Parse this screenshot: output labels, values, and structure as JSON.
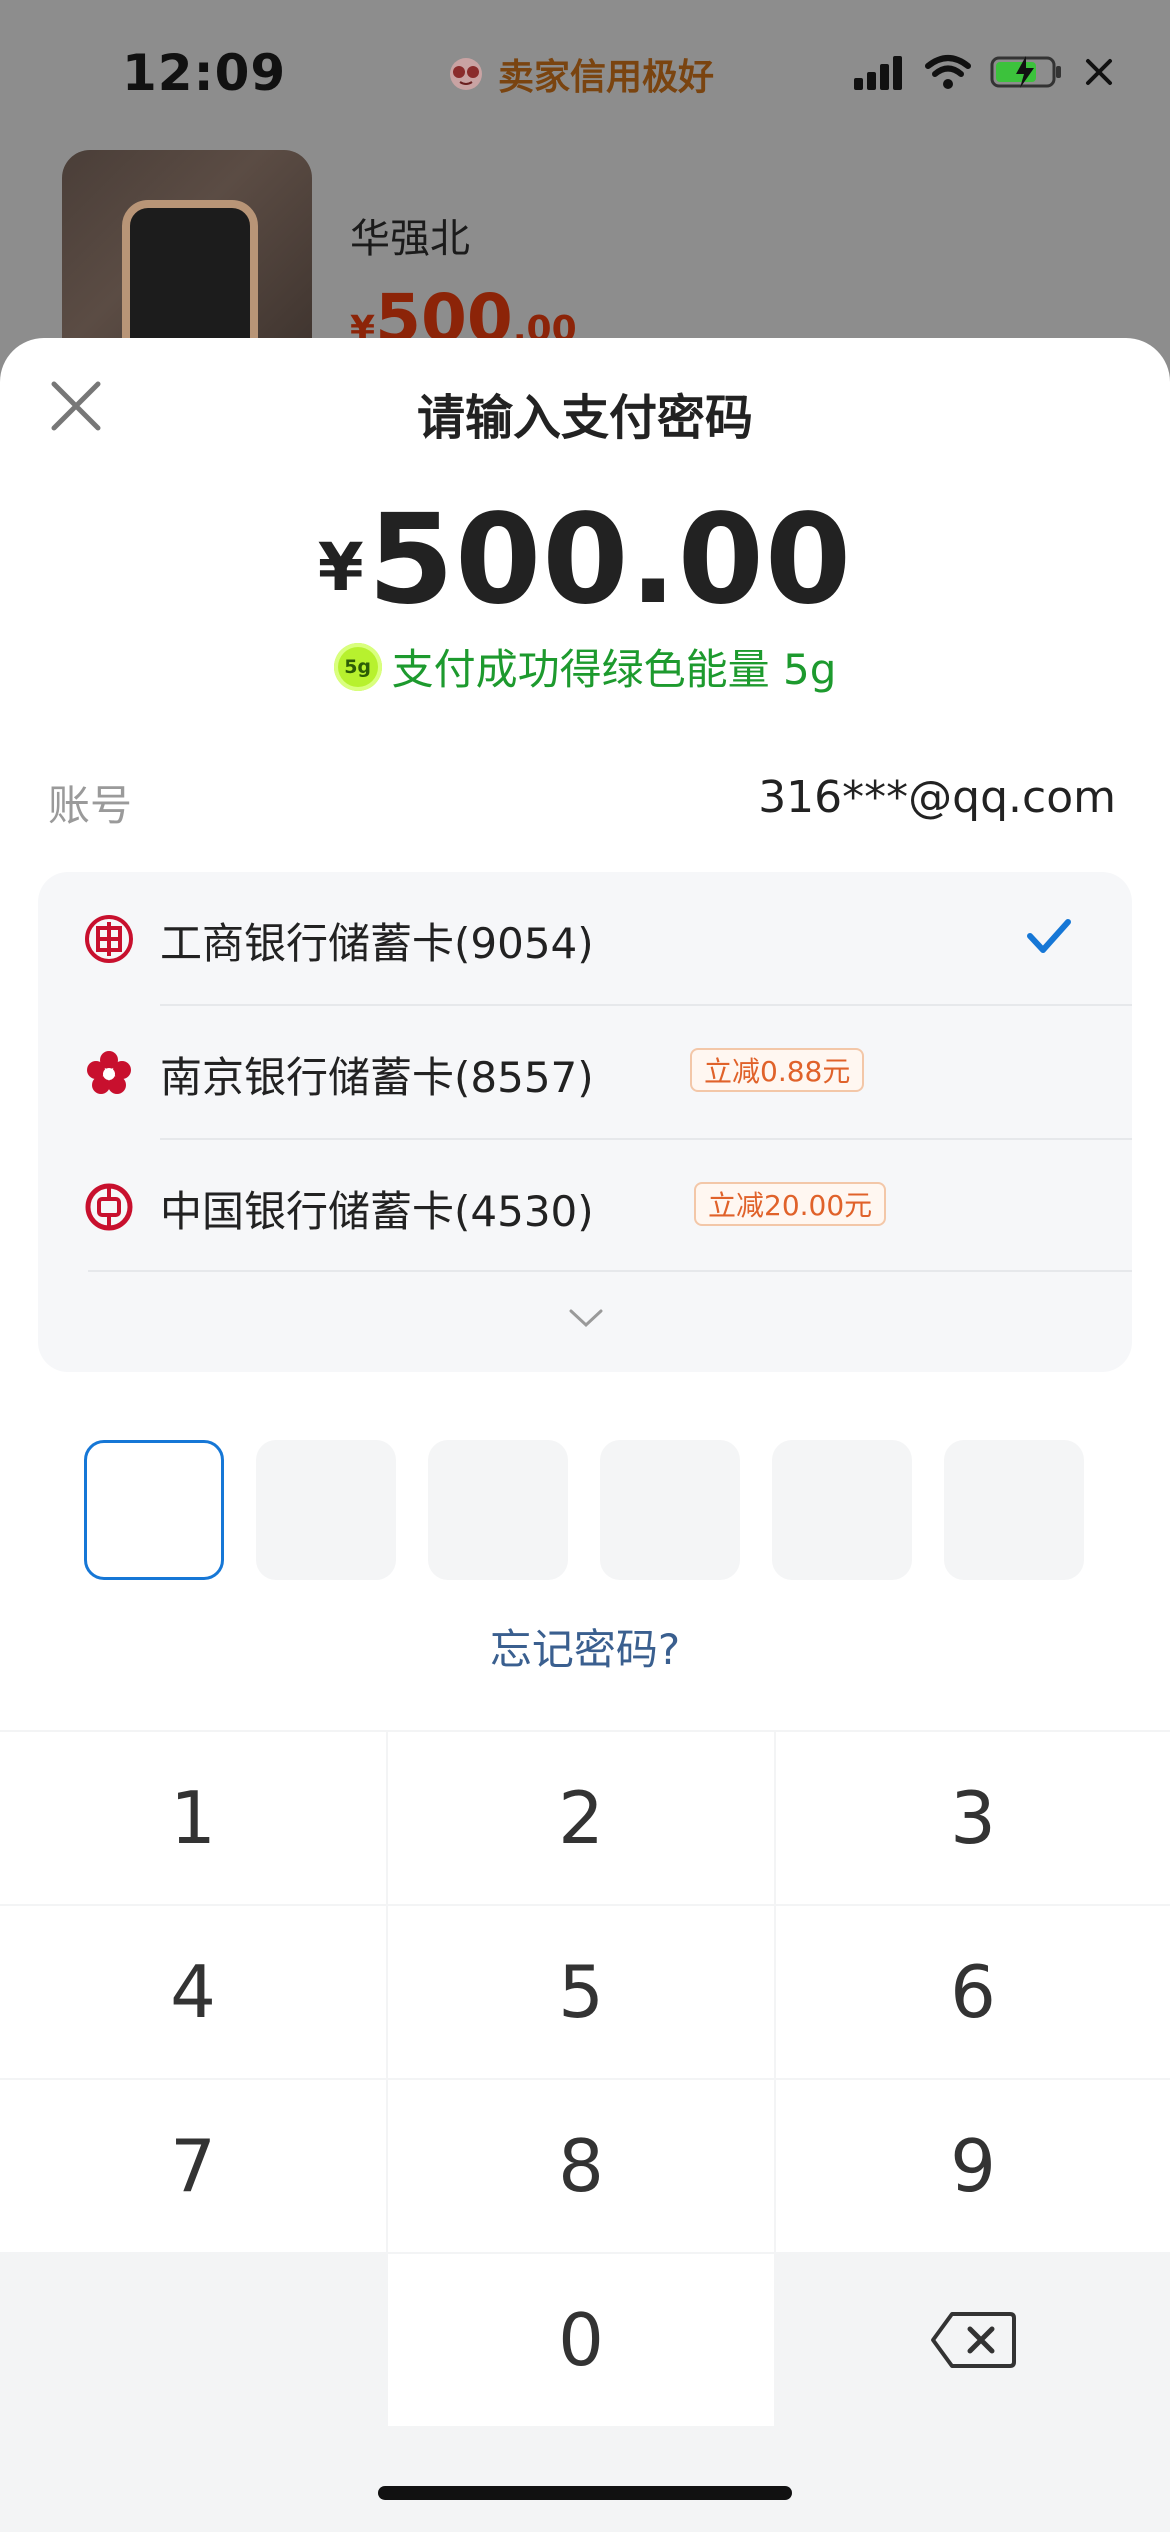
{
  "status_bar": {
    "time": "12:09",
    "badge_text": "卖家信用极好"
  },
  "background_item": {
    "title": "华强北",
    "price_currency": "¥",
    "price_integer": "500",
    "price_decimal": ".00"
  },
  "payment": {
    "title": "请输入支付密码",
    "currency": "¥",
    "amount": "500.00",
    "energy_icon_text": "5g",
    "energy_text": "支付成功得绿色能量 5g",
    "account_label": "账号",
    "account_value": "316***@qq.com",
    "cards": [
      {
        "name": "工商银行储蓄卡(9054)",
        "discount": "",
        "selected": true,
        "icon": "icbc-logo-icon"
      },
      {
        "name": "南京银行储蓄卡(8557)",
        "discount": "立减0.88元",
        "selected": false,
        "icon": "bank-of-nanjing-logo-icon"
      },
      {
        "name": "中国银行储蓄卡(4530)",
        "discount": "立减20.00元",
        "selected": false,
        "icon": "bank-of-china-logo-icon"
      }
    ],
    "pin_length": 6,
    "forgot_password": "忘记密码?"
  },
  "keypad": {
    "keys": [
      "1",
      "2",
      "3",
      "4",
      "5",
      "6",
      "7",
      "8",
      "9",
      "",
      "0",
      "backspace"
    ]
  },
  "colors": {
    "accent_blue": "#1677d6",
    "energy_green": "#1d9a2e",
    "discount_orange": "#e0622a",
    "price_red": "#8c2408",
    "bank_red": "#c8102e"
  }
}
